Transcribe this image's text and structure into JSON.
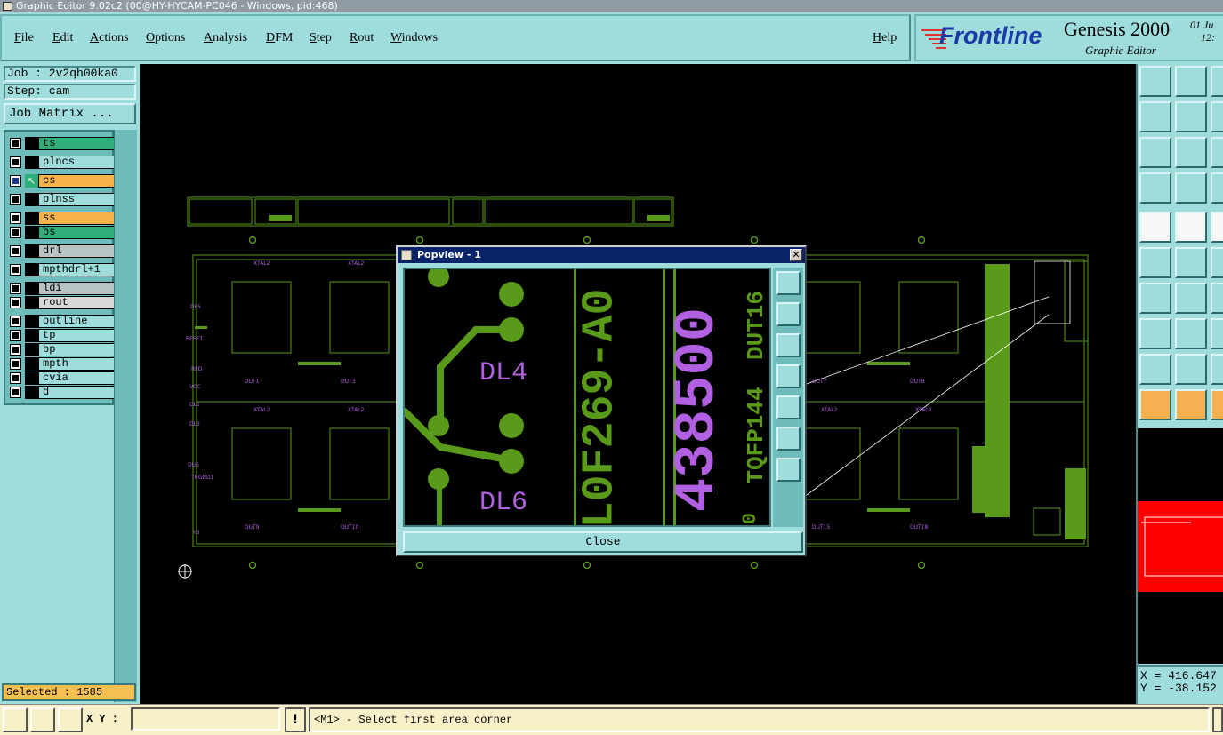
{
  "window": {
    "title": "Graphic Editor 9.02c2 (00@HY-HYCAM-PC046 - Windows, pid:468)"
  },
  "menu": {
    "items": [
      "File",
      "Edit",
      "Actions",
      "Options",
      "Analysis",
      "DFM",
      "Step",
      "Rout",
      "Windows"
    ],
    "help": "Help"
  },
  "brand": {
    "logo": "Frontline",
    "product": "Genesis 2000",
    "subtitle": "Graphic Editor",
    "date_fragment": "01 Ju",
    "time_fragment": "12:"
  },
  "job": {
    "job_line": "Job : 2v2qh00ka0",
    "step_line": "Step: cam",
    "matrix_button": "Job Matrix ..."
  },
  "layers": [
    {
      "name": "ts",
      "color": "#2fae7a",
      "state": "on"
    },
    {
      "name": "plncs",
      "color": "#9fdcdc",
      "state": "off"
    },
    {
      "name": "cs",
      "color": "#f5b34a",
      "state": "work"
    },
    {
      "name": "plnss",
      "color": "#9fdcdc",
      "state": "off"
    },
    {
      "name": "ss",
      "color": "#f5b34a",
      "state": "on"
    },
    {
      "name": "bs",
      "color": "#2fae7a",
      "state": "on"
    },
    {
      "name": "drl",
      "color": "#b8c4c4",
      "state": "off"
    },
    {
      "name": "mpthdrl+1",
      "color": "#9fdcdc",
      "state": "off"
    },
    {
      "name": "ldi",
      "color": "#b8c4c4",
      "state": "off"
    },
    {
      "name": "rout",
      "color": "#d8d8d8",
      "state": "off"
    },
    {
      "name": "outline",
      "color": "#9fdcdc",
      "state": "off"
    },
    {
      "name": "tp",
      "color": "#9fdcdc",
      "state": "off"
    },
    {
      "name": "bp",
      "color": "#9fdcdc",
      "state": "off"
    },
    {
      "name": "mpth",
      "color": "#9fdcdc",
      "state": "off"
    },
    {
      "name": "cvia",
      "color": "#9fdcdc",
      "state": "off"
    },
    {
      "name": "d",
      "color": "#9fdcdc",
      "state": "off"
    }
  ],
  "selection": {
    "text": "Selected : 1585"
  },
  "popview": {
    "title": "Popview - 1",
    "close_label": "Close",
    "labels": {
      "dl4": "DL4",
      "dl6": "DL6",
      "part": "L0F269-A0",
      "big_number": "438500",
      "pkg": "TQFP144",
      "dut": "DUT16",
      "zero": "0"
    }
  },
  "pcb_labels": {
    "xtal": "XTAL2",
    "duts": [
      "DUT1",
      "DUT3",
      "DUT7",
      "DUT8",
      "DUT9",
      "DUT10",
      "DUT15",
      "DUT18"
    ],
    "left_side": [
      "DL5",
      "RESET",
      "RFD",
      "VCC",
      "DL1",
      "DL3",
      "DU5",
      "TRGND1",
      "Y3"
    ]
  },
  "coords": {
    "x": "X = 416.647",
    "y": "Y = -38.152"
  },
  "status": {
    "xy_label": "X Y :",
    "input_value": "",
    "bang": "!",
    "prompt": "<M1> - Select first area corner"
  },
  "colors": {
    "panel": "#9fdcdc",
    "trace": "#5a9a1a",
    "silk": "#b060e0",
    "highlight": "#ff0000",
    "status_bg": "#f8f0c8",
    "title_bg": "#0a246a"
  }
}
